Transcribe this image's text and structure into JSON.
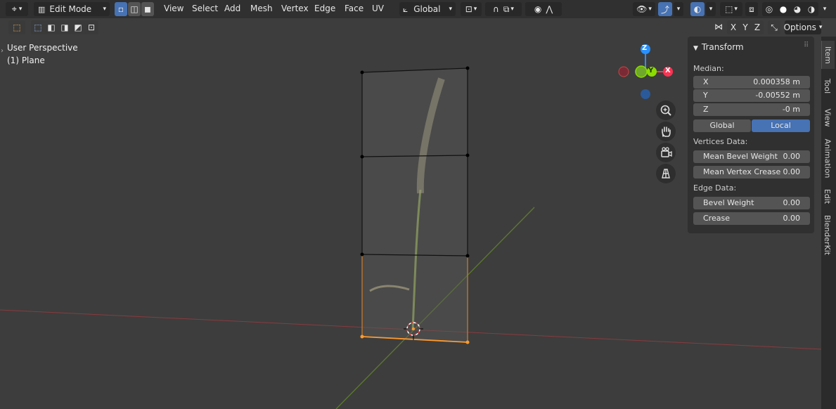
{
  "header": {
    "mode_label": "Edit Mode",
    "menus": [
      "View",
      "Select",
      "Add",
      "Mesh",
      "Vertex",
      "Edge",
      "Face",
      "UV"
    ],
    "orientation_label": "Global",
    "options_label": "Options"
  },
  "axis_buttons": [
    "X",
    "Y",
    "Z"
  ],
  "viewport": {
    "perspective_label": "User Perspective",
    "object_label": "(1) Plane",
    "gizmo_labels": {
      "z": "Z",
      "y": "Y",
      "x": "X"
    }
  },
  "npanel": {
    "section_title": "Transform",
    "median_label": "Median:",
    "fields": [
      {
        "label": "X",
        "value": "0.000358 m"
      },
      {
        "label": "Y",
        "value": "-0.00552 m"
      },
      {
        "label": "Z",
        "value": "-0 m"
      }
    ],
    "space_global": "Global",
    "space_local": "Local",
    "vertices_data_label": "Vertices Data:",
    "vertex_fields": [
      {
        "label": "Mean Bevel Weight",
        "value": "0.00"
      },
      {
        "label": "Mean Vertex Crease",
        "value": "0.00"
      }
    ],
    "edge_data_label": "Edge Data:",
    "edge_fields": [
      {
        "label": "Bevel Weight",
        "value": "0.00"
      },
      {
        "label": "Crease",
        "value": "0.00"
      }
    ]
  },
  "sidebar_tabs": [
    "Item",
    "Tool",
    "View",
    "Animation",
    "Edit",
    "BlenderKit"
  ],
  "colors": {
    "accent": "#4772b3",
    "x_axis": "#ff3352",
    "y_axis": "#8bdc00",
    "z_axis": "#2890ff",
    "selected_edge": "#ff9a2e"
  }
}
